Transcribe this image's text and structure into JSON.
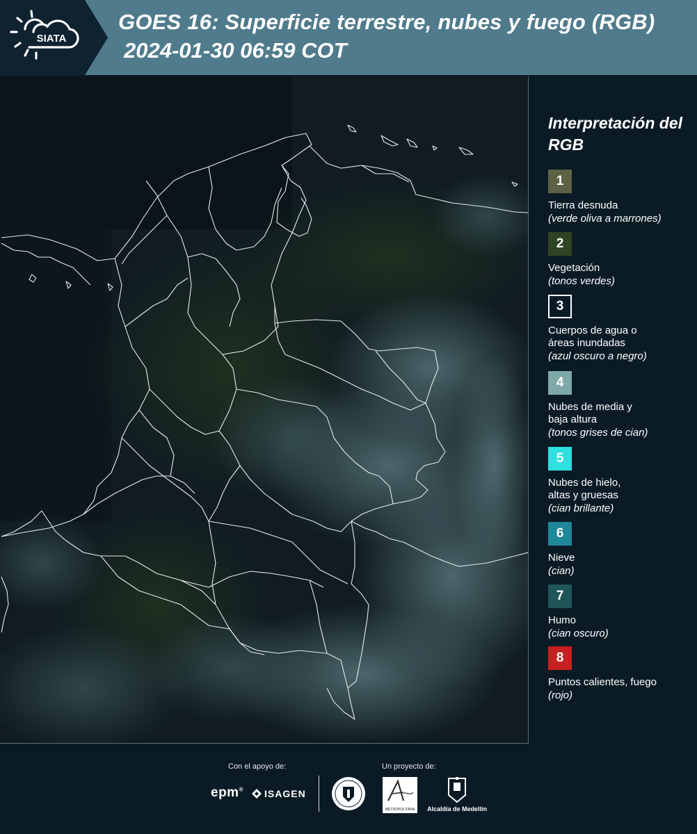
{
  "header": {
    "logo_text": "SIATA",
    "title_line1": "GOES 16: Superficie terrestre, nubes y fuego (RGB)",
    "title_line2": "2024-01-30 06:59 COT"
  },
  "map": {
    "caption": "",
    "colors": {
      "background": "#0f1b21",
      "clouds": "#4f6e72",
      "borders": "#e6ecef"
    }
  },
  "legend": {
    "title": "Interpretación del RGB",
    "items": [
      {
        "number": "1",
        "label": "Tierra desnuda",
        "sublabel": "(verde oliva a marrones)",
        "color": "#5e6244",
        "border": "#5e6244"
      },
      {
        "number": "2",
        "label": "Vegetación",
        "sublabel": "(tonos verdes)",
        "color": "#2e4422",
        "border": "#2e4422"
      },
      {
        "number": "3",
        "label": "Cuerpos de agua o\náreas inundadas",
        "sublabel": "(azul oscuro a negro)",
        "color": "#0b1b26",
        "border": "#ffffff"
      },
      {
        "number": "4",
        "label": "Nubes de media y\nbaja altura",
        "sublabel": "(tonos grises de cian)",
        "color": "#7fa8a9",
        "border": "#7fa8a9"
      },
      {
        "number": "5",
        "label": "Nubes de hielo,\naltas y gruesas",
        "sublabel": "(cian brillante)",
        "color": "#2ee0e0",
        "border": "#2ee0e0"
      },
      {
        "number": "6",
        "label": "Nieve",
        "sublabel": "(cian)",
        "color": "#1f8799",
        "border": "#1f8799"
      },
      {
        "number": "7",
        "label": "Humo",
        "sublabel": "(cian oscuro)",
        "color": "#1d5558",
        "border": "#1d5558"
      },
      {
        "number": "8",
        "label": "Puntos calientes, fuego",
        "sublabel": "(rojo)",
        "color": "#c62020",
        "border": "#c62020"
      }
    ]
  },
  "footer": {
    "support_label": "Con el apoyo de:",
    "project_label": "Un proyecto de:",
    "epm": "epm",
    "isagen": "ISAGEN",
    "area_logo_text": "METROPOLITANA",
    "medellin": "Alcaldía de Medellín"
  }
}
